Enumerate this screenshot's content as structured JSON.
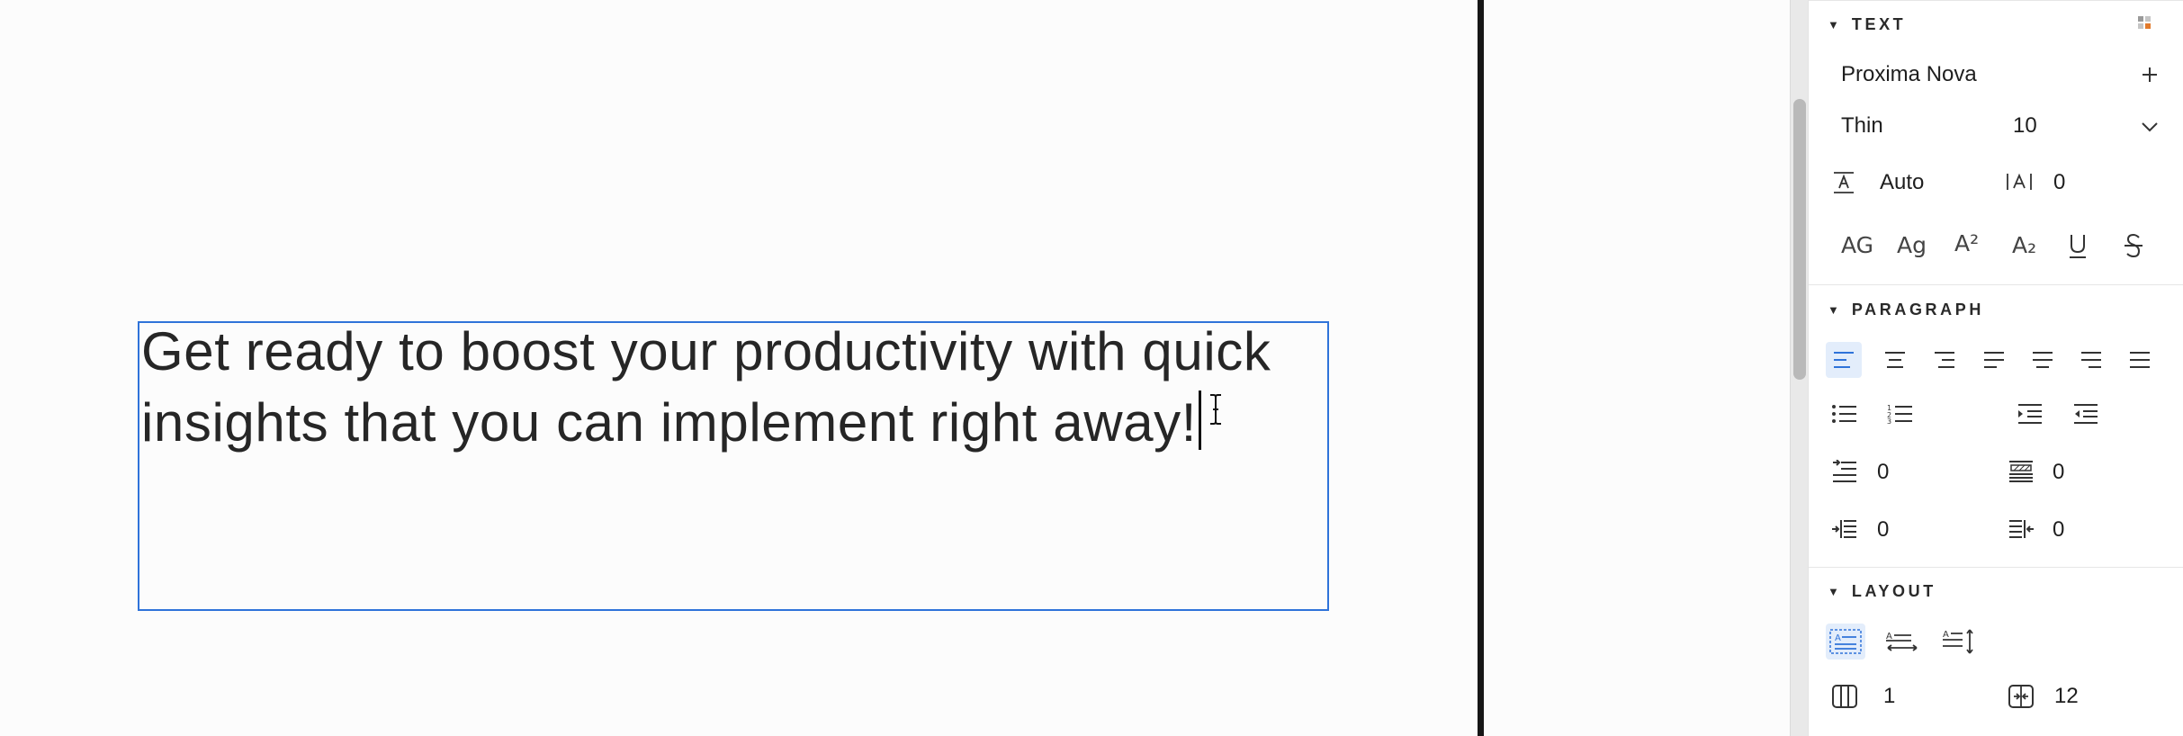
{
  "canvas": {
    "text_line_1": "Get ready to boost your productivity with quick",
    "text_line_2": "insights that you can implement right away!"
  },
  "text_section": {
    "title": "TEXT",
    "font_family": "Proxima Nova",
    "font_weight": "Thin",
    "font_size": "10",
    "line_height": "Auto",
    "letter_spacing": "0",
    "case_labels": [
      "AG",
      "Ag",
      "A²",
      "A₂"
    ]
  },
  "paragraph_section": {
    "title": "PARAGRAPH",
    "first_line_indent": "0",
    "paragraph_spacing": "0",
    "left_indent": "0",
    "right_indent": "0"
  },
  "layout_section": {
    "title": "LAYOUT",
    "columns": "1",
    "column_gap": "12"
  },
  "colors": {
    "selection": "#2f73d9",
    "divider": "#161616",
    "panel_bg": "#ffffff"
  },
  "icons": [
    "collapse-triangle-icon",
    "panel-grid-icon",
    "plus-icon",
    "chevron-down-icon",
    "line-height-icon",
    "letter-spacing-icon",
    "uppercase-icon",
    "title-case-icon",
    "superscript-icon",
    "subscript-icon",
    "underline-icon",
    "strikethrough-icon",
    "align-left-icon",
    "align-center-icon",
    "align-right-icon",
    "justify-left-icon",
    "justify-center-icon",
    "justify-right-icon",
    "justify-all-icon",
    "bulleted-list-icon",
    "numbered-list-icon",
    "increase-indent-icon",
    "decrease-indent-icon",
    "first-line-indent-icon",
    "paragraph-spacing-icon",
    "left-indent-icon",
    "right-indent-icon",
    "layout-fixed-icon",
    "layout-auto-width-icon",
    "layout-auto-height-icon",
    "columns-icon",
    "column-gap-icon"
  ]
}
